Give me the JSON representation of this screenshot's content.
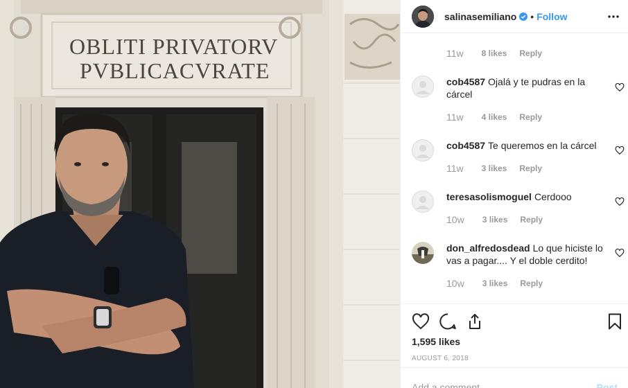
{
  "photo": {
    "inscription_line1": "OBLITI PRIVATORV",
    "inscription_line2": "PVBLICACVRATE"
  },
  "header": {
    "username": "salinasemiliano",
    "separator": "•",
    "follow_label": "Follow",
    "verified_icon": "verified-badge-icon",
    "more_icon": "more-options-icon"
  },
  "comments": {
    "top_meta": {
      "time": "11w",
      "likes": "8 likes",
      "reply": "Reply"
    },
    "items": [
      {
        "user": "cob4587",
        "text": "Ojalá y te pudras en la cárcel",
        "time": "11w",
        "likes": "4 likes",
        "reply": "Reply"
      },
      {
        "user": "cob4587",
        "text": "Te queremos en la cárcel",
        "time": "11w",
        "likes": "3 likes",
        "reply": "Reply"
      },
      {
        "user": "teresasolismoguel",
        "text": "Cerdooo",
        "time": "10w",
        "likes": "3 likes",
        "reply": "Reply"
      },
      {
        "user": "don_alfredosdead",
        "text": "Lo que hiciste lo vas a pagar.... Y el doble cerdito!",
        "time": "10w",
        "likes": "3 likes",
        "reply": "Reply"
      }
    ]
  },
  "actions": {
    "icons": [
      "heart-icon",
      "comment-icon",
      "share-icon",
      "bookmark-icon"
    ],
    "like_count": "1,595 likes",
    "date": "AUGUST 6, 2018"
  },
  "add_comment": {
    "placeholder": "Add a comment…",
    "post_label": "Post"
  },
  "colors": {
    "link_blue": "#3897f0",
    "muted_gray": "#999999",
    "text": "#262626",
    "border": "#efefef",
    "post_disabled": "#b2dffc"
  }
}
